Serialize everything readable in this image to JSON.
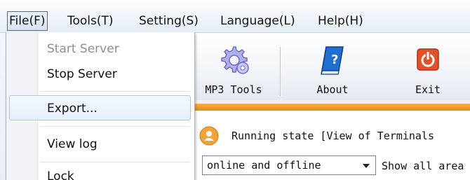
{
  "menubar": {
    "items": [
      {
        "label": "File(F)",
        "active": true
      },
      {
        "label": "Tools(T)"
      },
      {
        "label": "Setting(S)"
      },
      {
        "label": "Language(L)"
      },
      {
        "label": "Help(H)"
      }
    ]
  },
  "file_menu": {
    "items": [
      {
        "label": "Start Server",
        "enabled": false
      },
      {
        "label": "Stop Server",
        "enabled": true
      },
      {
        "label": "Export...",
        "enabled": true,
        "highlighted": true
      },
      {
        "label": "View log",
        "enabled": true
      },
      {
        "label": "Lock",
        "enabled": true
      }
    ]
  },
  "toolbar": {
    "tools": [
      {
        "label": "MP3 Tools",
        "icon": "gears-icon"
      },
      {
        "label": "About",
        "icon": "help-book-icon"
      },
      {
        "label": "Exit",
        "icon": "power-icon"
      }
    ]
  },
  "colors": {
    "accent_orange": "#e98c15",
    "exit_red": "#e2512a",
    "book_blue": "#1f6fd1",
    "gear_lilac": "#a9a6e6"
  },
  "content": {
    "status_text": "Running state [View of Terminals",
    "filter_select_value": "online and offline",
    "show_all_text": "Show all area"
  }
}
